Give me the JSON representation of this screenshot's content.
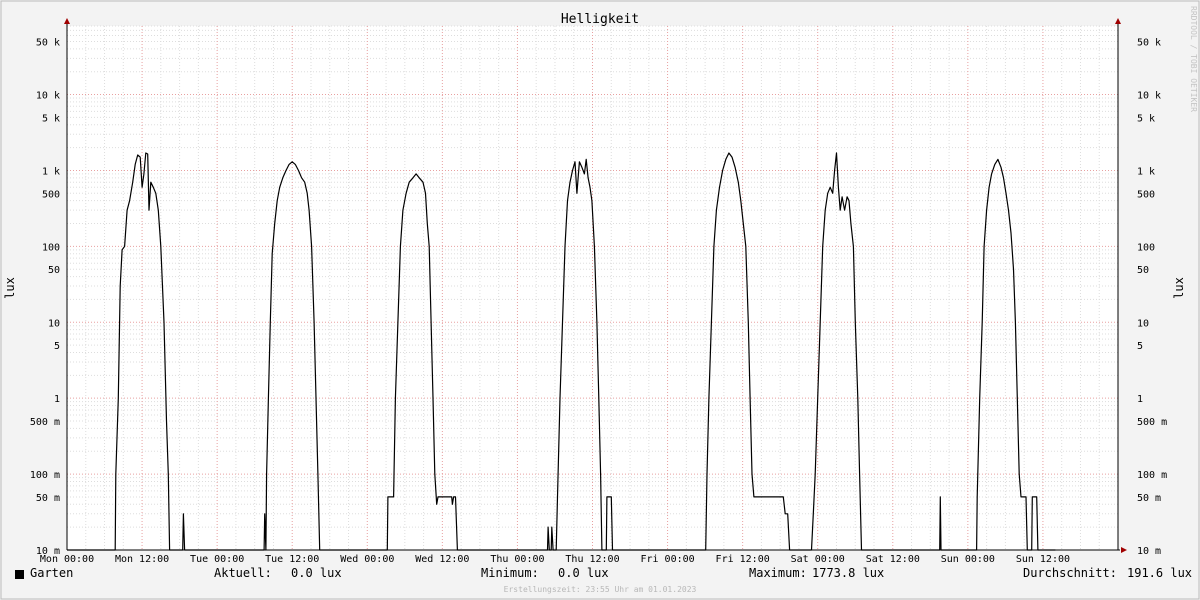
{
  "chart_data": {
    "type": "line",
    "title": "Helligkeit",
    "ylabel": "lux",
    "yscale": "log",
    "ylim": [
      0.01,
      80000
    ],
    "y_ticks": [
      {
        "value": 50000,
        "label": "50 k"
      },
      {
        "value": 10000,
        "label": "10 k"
      },
      {
        "value": 5000,
        "label": "5 k"
      },
      {
        "value": 1000,
        "label": "1 k"
      },
      {
        "value": 500,
        "label": "500"
      },
      {
        "value": 100,
        "label": "100"
      },
      {
        "value": 50,
        "label": "50"
      },
      {
        "value": 10,
        "label": "10"
      },
      {
        "value": 5,
        "label": "5"
      },
      {
        "value": 1,
        "label": "1"
      },
      {
        "value": 0.5,
        "label": "500 m"
      },
      {
        "value": 0.1,
        "label": "100 m"
      },
      {
        "value": 0.05,
        "label": "50 m"
      },
      {
        "value": 0.01,
        "label": "10 m"
      }
    ],
    "x_unit": "hours",
    "xlim": [
      0,
      168
    ],
    "x_ticks": [
      {
        "value": 0,
        "label": "Mon 00:00"
      },
      {
        "value": 12,
        "label": "Mon 12:00"
      },
      {
        "value": 24,
        "label": "Tue 00:00"
      },
      {
        "value": 36,
        "label": "Tue 12:00"
      },
      {
        "value": 48,
        "label": "Wed 00:00"
      },
      {
        "value": 60,
        "label": "Wed 12:00"
      },
      {
        "value": 72,
        "label": "Thu 00:00"
      },
      {
        "value": 84,
        "label": "Thu 12:00"
      },
      {
        "value": 96,
        "label": "Fri 00:00"
      },
      {
        "value": 108,
        "label": "Fri 12:00"
      },
      {
        "value": 120,
        "label": "Sat 00:00"
      },
      {
        "value": 132,
        "label": "Sat 12:00"
      },
      {
        "value": 144,
        "label": "Sun 00:00"
      },
      {
        "value": 156,
        "label": "Sun 12:00"
      }
    ],
    "grid": true,
    "series": [
      {
        "name": "Garten",
        "color": "#000000",
        "points": [
          [
            0,
            0.01
          ],
          [
            7.7,
            0.01
          ],
          [
            7.8,
            0.1
          ],
          [
            8.2,
            1
          ],
          [
            8.5,
            30
          ],
          [
            8.8,
            90
          ],
          [
            9.2,
            100
          ],
          [
            9.6,
            300
          ],
          [
            10,
            400
          ],
          [
            10.5,
            700
          ],
          [
            10.9,
            1200
          ],
          [
            11.3,
            1600
          ],
          [
            11.7,
            1500
          ],
          [
            12,
            600
          ],
          [
            12.3,
            900
          ],
          [
            12.6,
            1700
          ],
          [
            12.9,
            1650
          ],
          [
            13.1,
            300
          ],
          [
            13.4,
            700
          ],
          [
            13.8,
            600
          ],
          [
            14.2,
            500
          ],
          [
            14.6,
            300
          ],
          [
            15,
            100
          ],
          [
            15.5,
            10
          ],
          [
            15.9,
            0.5
          ],
          [
            16.2,
            0.1
          ],
          [
            16.4,
            0.01
          ],
          [
            18.5,
            0.01
          ],
          [
            18.6,
            0.03
          ],
          [
            18.8,
            0.01
          ],
          [
            31.5,
            0.01
          ],
          [
            31.6,
            0.03
          ],
          [
            31.8,
            0.01
          ],
          [
            31.9,
            0.1
          ],
          [
            32.2,
            1
          ],
          [
            32.5,
            10
          ],
          [
            32.8,
            80
          ],
          [
            33.2,
            200
          ],
          [
            33.6,
            400
          ],
          [
            34,
            600
          ],
          [
            34.5,
            800
          ],
          [
            35,
            1000
          ],
          [
            35.5,
            1200
          ],
          [
            36,
            1300
          ],
          [
            36.5,
            1200
          ],
          [
            37,
            1000
          ],
          [
            37.5,
            800
          ],
          [
            38,
            700
          ],
          [
            38.4,
            500
          ],
          [
            38.7,
            300
          ],
          [
            39.1,
            100
          ],
          [
            39.5,
            10
          ],
          [
            39.8,
            1
          ],
          [
            40.1,
            0.1
          ],
          [
            40.4,
            0.01
          ],
          [
            51.2,
            0.01
          ],
          [
            51.3,
            0.05
          ],
          [
            52.2,
            0.05
          ],
          [
            52.5,
            1
          ],
          [
            52.9,
            10
          ],
          [
            53.3,
            100
          ],
          [
            53.7,
            300
          ],
          [
            54.2,
            500
          ],
          [
            54.7,
            700
          ],
          [
            55.3,
            800
          ],
          [
            55.8,
            900
          ],
          [
            56.3,
            800
          ],
          [
            56.9,
            700
          ],
          [
            57.3,
            500
          ],
          [
            57.6,
            200
          ],
          [
            57.9,
            100
          ],
          [
            58.2,
            10
          ],
          [
            58.5,
            1
          ],
          [
            58.8,
            0.1
          ],
          [
            59.1,
            0.04
          ],
          [
            59.3,
            0.05
          ],
          [
            61.5,
            0.05
          ],
          [
            61.6,
            0.04
          ],
          [
            61.8,
            0.05
          ],
          [
            62.1,
            0.05
          ],
          [
            62.4,
            0.01
          ],
          [
            76.8,
            0.01
          ],
          [
            76.9,
            0.02
          ],
          [
            77.1,
            0.01
          ],
          [
            77.4,
            0.01
          ],
          [
            77.5,
            0.02
          ],
          [
            77.7,
            0.01
          ],
          [
            78.2,
            0.01
          ],
          [
            78.4,
            0.05
          ],
          [
            78.8,
            1
          ],
          [
            79.2,
            10
          ],
          [
            79.6,
            100
          ],
          [
            80,
            400
          ],
          [
            80.4,
            700
          ],
          [
            80.8,
            1000
          ],
          [
            81.2,
            1300
          ],
          [
            81.5,
            500
          ],
          [
            81.9,
            1300
          ],
          [
            82.3,
            1100
          ],
          [
            82.7,
            900
          ],
          [
            83,
            1400
          ],
          [
            83.3,
            800
          ],
          [
            83.6,
            600
          ],
          [
            83.9,
            400
          ],
          [
            84.3,
            100
          ],
          [
            84.7,
            10
          ],
          [
            85,
            1
          ],
          [
            85.3,
            0.1
          ],
          [
            85.5,
            0.01
          ],
          [
            86.2,
            0.01
          ],
          [
            86.3,
            0.05
          ],
          [
            87,
            0.05
          ],
          [
            87.2,
            0.01
          ],
          [
            102.1,
            0.01
          ],
          [
            102.3,
            0.1
          ],
          [
            102.6,
            1
          ],
          [
            103,
            10
          ],
          [
            103.4,
            100
          ],
          [
            103.8,
            300
          ],
          [
            104.3,
            600
          ],
          [
            104.8,
            1000
          ],
          [
            105.3,
            1400
          ],
          [
            105.8,
            1700
          ],
          [
            106.3,
            1500
          ],
          [
            106.8,
            1100
          ],
          [
            107.3,
            700
          ],
          [
            107.7,
            400
          ],
          [
            108.1,
            200
          ],
          [
            108.5,
            100
          ],
          [
            108.9,
            10
          ],
          [
            109.2,
            1
          ],
          [
            109.5,
            0.1
          ],
          [
            109.8,
            0.05
          ],
          [
            114.5,
            0.05
          ],
          [
            114.8,
            0.03
          ],
          [
            115.2,
            0.03
          ],
          [
            115.5,
            0.01
          ],
          [
            119,
            0.01
          ],
          [
            119.3,
            0.03
          ],
          [
            119.6,
            0.1
          ],
          [
            120,
            1
          ],
          [
            120.4,
            10
          ],
          [
            120.8,
            100
          ],
          [
            121.2,
            300
          ],
          [
            121.6,
            500
          ],
          [
            122,
            600
          ],
          [
            122.4,
            500
          ],
          [
            122.7,
            1000
          ],
          [
            123,
            1700
          ],
          [
            123.3,
            600
          ],
          [
            123.6,
            300
          ],
          [
            123.9,
            450
          ],
          [
            124.3,
            300
          ],
          [
            124.7,
            450
          ],
          [
            125,
            400
          ],
          [
            125.3,
            200
          ],
          [
            125.7,
            100
          ],
          [
            126,
            10
          ],
          [
            126.4,
            1
          ],
          [
            126.7,
            0.1
          ],
          [
            127,
            0.01
          ],
          [
            139.5,
            0.01
          ],
          [
            139.6,
            0.05
          ],
          [
            139.7,
            0.01
          ],
          [
            145.4,
            0.01
          ],
          [
            145.5,
            0.05
          ],
          [
            145.9,
            1
          ],
          [
            146.3,
            10
          ],
          [
            146.6,
            100
          ],
          [
            147,
            300
          ],
          [
            147.4,
            600
          ],
          [
            147.8,
            900
          ],
          [
            148.3,
            1200
          ],
          [
            148.8,
            1400
          ],
          [
            149.3,
            1100
          ],
          [
            149.7,
            800
          ],
          [
            150.1,
            500
          ],
          [
            150.5,
            300
          ],
          [
            150.9,
            150
          ],
          [
            151.3,
            50
          ],
          [
            151.6,
            10
          ],
          [
            151.9,
            1
          ],
          [
            152.2,
            0.1
          ],
          [
            152.5,
            0.05
          ],
          [
            153.3,
            0.05
          ],
          [
            153.5,
            0.01
          ],
          [
            154.2,
            0.01
          ],
          [
            154.3,
            0.05
          ],
          [
            155,
            0.05
          ],
          [
            155.2,
            0.01
          ],
          [
            158,
            0.01
          ]
        ]
      }
    ]
  },
  "legend": {
    "series_name": "Garten",
    "current_label": "Aktuell:",
    "current_value": "0.0 lux",
    "min_label": "Minimum:",
    "min_value": "0.0 lux",
    "max_label": "Maximum:",
    "max_value": "1773.8 lux",
    "avg_label": "Durchschnitt:",
    "avg_value": "191.6 lux"
  },
  "footer": {
    "timestamp": "Erstellungszeit: 23:55 Uhr am 01.01.2023"
  },
  "watermark": "RRDTOOL / TOBI OETIKER",
  "colors": {
    "background": "#f3f3f3",
    "canvas": "#ffffff",
    "grid_minor": "#dddddd",
    "grid_major": "#e8a0a0",
    "axis_arrow": "#a00000",
    "line": "#000000"
  }
}
